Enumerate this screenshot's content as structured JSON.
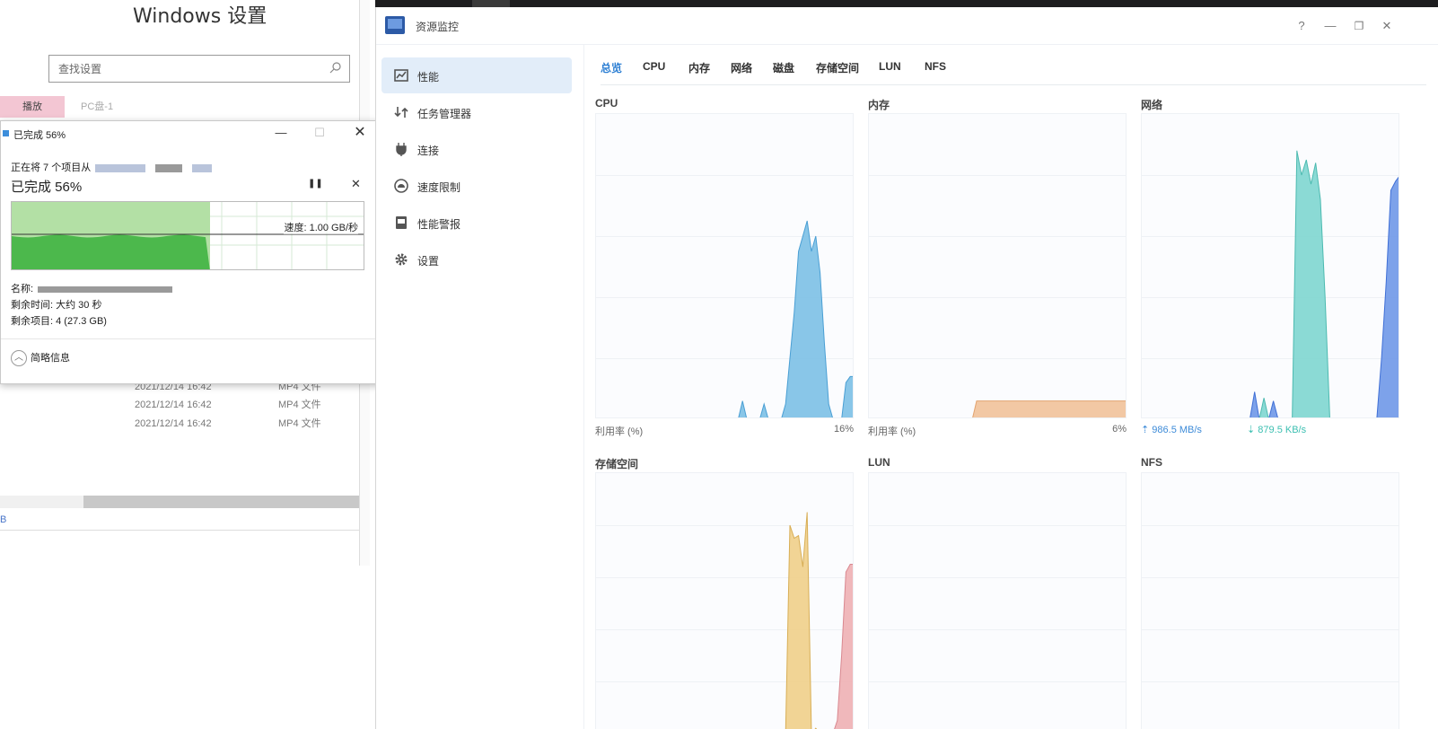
{
  "settings": {
    "title": "Windows 设置",
    "search_placeholder": "查找设置",
    "tab_active": "播放",
    "tab_other": "PC盘-1",
    "files": [
      {
        "date": "2021/12/14 16:42",
        "type": "MP4 文件"
      },
      {
        "date": "2021/12/14 16:42",
        "type": "MP4 文件"
      },
      {
        "date": "2021/12/14 16:42",
        "type": "MP4 文件"
      }
    ],
    "footer": "B"
  },
  "copy_dialog": {
    "title": "已完成 56%",
    "from_text": "正在将 7 个项目从",
    "percent_text": "已完成 56%",
    "progress_percent": 56,
    "speed": "速度: 1.00 GB/秒",
    "name_label": "名称:",
    "time_label": "剩余时间: 大约 30 秒",
    "remain_label": "剩余项目: 4 (27.3 GB)",
    "less_info": "简略信息"
  },
  "monitor": {
    "title": "资源监控",
    "nav": [
      {
        "label": "性能",
        "icon": "performance-icon"
      },
      {
        "label": "任务管理器",
        "icon": "task-manager-icon"
      },
      {
        "label": "连接",
        "icon": "plug-icon"
      },
      {
        "label": "速度限制",
        "icon": "speed-limit-icon"
      },
      {
        "label": "性能警报",
        "icon": "alert-icon"
      },
      {
        "label": "设置",
        "icon": "gear-icon"
      }
    ],
    "tabs": [
      "总览",
      "CPU",
      "内存",
      "网络",
      "磁盘",
      "存储空间",
      "LUN",
      "NFS"
    ],
    "panels": {
      "cpu": {
        "title": "CPU",
        "footer_label": "利用率 (%)",
        "footer_value": "16%"
      },
      "memory": {
        "title": "内存",
        "footer_label": "利用率 (%)",
        "footer_value": "6%"
      },
      "network": {
        "title": "网络",
        "upload": "986.5 MB/s",
        "download": "879.5 KB/s"
      },
      "storage": {
        "title": "存储空间"
      },
      "lun": {
        "title": "LUN"
      },
      "nfs": {
        "title": "NFS"
      }
    }
  },
  "chart_data": [
    {
      "type": "area",
      "title": "CPU",
      "ylabel": "利用率 (%)",
      "series": [
        {
          "values": [
            0,
            0,
            0,
            0,
            0,
            0,
            0,
            0,
            0,
            0,
            0,
            0,
            0,
            0,
            0,
            0,
            0,
            0,
            0,
            0,
            0,
            0,
            0,
            0,
            0,
            0,
            0,
            0,
            0,
            0,
            0,
            0,
            0,
            0,
            6,
            0,
            0,
            0,
            0,
            5,
            0,
            0,
            0,
            0,
            5,
            20,
            35,
            55,
            60,
            65,
            55,
            60,
            48,
            25,
            5,
            0,
            0,
            0,
            12,
            14,
            14
          ]
        }
      ],
      "ylim": [
        0,
        100
      ],
      "color": "#7cc0e6"
    },
    {
      "type": "area",
      "title": "内存",
      "ylabel": "利用率 (%)",
      "series": [
        {
          "values": [
            0,
            0,
            0,
            0,
            0,
            0,
            0,
            0,
            0,
            0,
            0,
            0,
            0,
            0,
            0,
            0,
            0,
            0,
            0,
            0,
            0,
            0,
            0,
            0,
            0,
            6,
            6,
            6,
            6,
            6,
            6,
            6,
            6,
            6,
            6,
            6,
            6,
            6,
            6,
            6,
            6,
            6,
            6,
            6,
            6,
            6,
            6,
            6,
            6,
            6,
            6,
            6,
            6,
            6,
            6,
            6,
            6,
            6,
            6,
            6,
            6
          ]
        }
      ],
      "ylim": [
        0,
        100
      ],
      "color": "#f1c29a"
    },
    {
      "type": "area",
      "title": "网络",
      "series": [
        {
          "name": "986.5 MB/s",
          "values": [
            0,
            0,
            0,
            0,
            0,
            0,
            0,
            0,
            0,
            0,
            0,
            0,
            0,
            0,
            0,
            0,
            0,
            0,
            0,
            0,
            0,
            0,
            0,
            0,
            9,
            0,
            0,
            0,
            6,
            0,
            0,
            0,
            0,
            0,
            0,
            0,
            0,
            0,
            0,
            0,
            0,
            0,
            0,
            0,
            0,
            0,
            0,
            0,
            0,
            0,
            0,
            20,
            45,
            75,
            78,
            80
          ]
        },
        {
          "name": "879.5 KB/s",
          "values": [
            0,
            0,
            0,
            0,
            0,
            0,
            0,
            0,
            0,
            0,
            0,
            0,
            0,
            0,
            0,
            0,
            0,
            0,
            0,
            0,
            0,
            0,
            0,
            0,
            0,
            0,
            7,
            0,
            0,
            0,
            0,
            0,
            0,
            88,
            80,
            85,
            77,
            84,
            72,
            40,
            0,
            0,
            0,
            0,
            0,
            0,
            0,
            0,
            0,
            0,
            0,
            0,
            0,
            0,
            0,
            0
          ]
        }
      ],
      "ylim": [
        0,
        100
      ]
    },
    {
      "type": "area",
      "title": "存储空间",
      "series": [
        {
          "values": [
            0,
            0,
            0,
            0,
            0,
            0,
            0,
            0,
            0,
            0,
            0,
            0,
            0,
            0,
            0,
            0,
            0,
            0,
            0,
            0,
            0,
            0,
            0,
            0,
            0,
            0,
            0,
            0,
            0,
            0,
            0,
            0,
            0,
            0,
            0,
            0,
            0,
            0,
            0,
            0,
            0,
            0,
            0,
            0,
            0,
            80,
            75,
            76,
            64,
            85,
            0,
            2,
            0,
            0,
            0,
            0,
            0,
            0,
            0,
            0,
            0
          ]
        },
        {
          "values": [
            0,
            0,
            0,
            0,
            0,
            0,
            0,
            0,
            0,
            0,
            0,
            0,
            0,
            0,
            0,
            0,
            0,
            0,
            0,
            0,
            0,
            0,
            0,
            0,
            0,
            0,
            0,
            0,
            0,
            0,
            0,
            0,
            0,
            0,
            0,
            0,
            0,
            0,
            0,
            0,
            0,
            0,
            0,
            0,
            0,
            0,
            0,
            0,
            0,
            0,
            0,
            0,
            0,
            0,
            0,
            0,
            5,
            30,
            62,
            65,
            65
          ]
        }
      ],
      "ylim": [
        0,
        100
      ]
    },
    {
      "type": "area",
      "title": "LUN",
      "series": [],
      "ylim": [
        0,
        100
      ]
    },
    {
      "type": "area",
      "title": "NFS",
      "series": [],
      "ylim": [
        0,
        100
      ]
    }
  ]
}
